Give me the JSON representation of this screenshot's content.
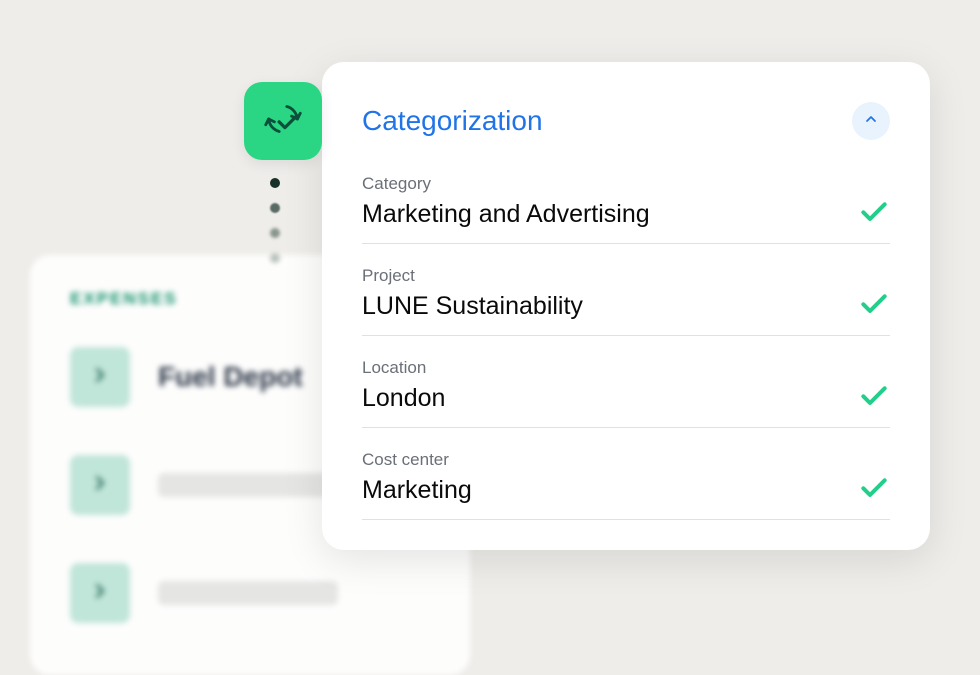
{
  "expenses": {
    "title": "EXPENSES",
    "items": [
      {
        "label": "Fuel Depot",
        "has_label": true
      },
      {
        "label": "",
        "has_label": false
      },
      {
        "label": "",
        "has_label": false
      }
    ]
  },
  "card": {
    "title": "Categorization",
    "fields": [
      {
        "label": "Category",
        "value": "Marketing and Advertising"
      },
      {
        "label": "Project",
        "value": "LUNE Sustainability"
      },
      {
        "label": "Location",
        "value": "London"
      },
      {
        "label": "Cost center",
        "value": "Marketing"
      }
    ]
  },
  "colors": {
    "accent_green": "#2ad684",
    "accent_blue": "#2074e8",
    "check_green": "#22cf8a"
  }
}
